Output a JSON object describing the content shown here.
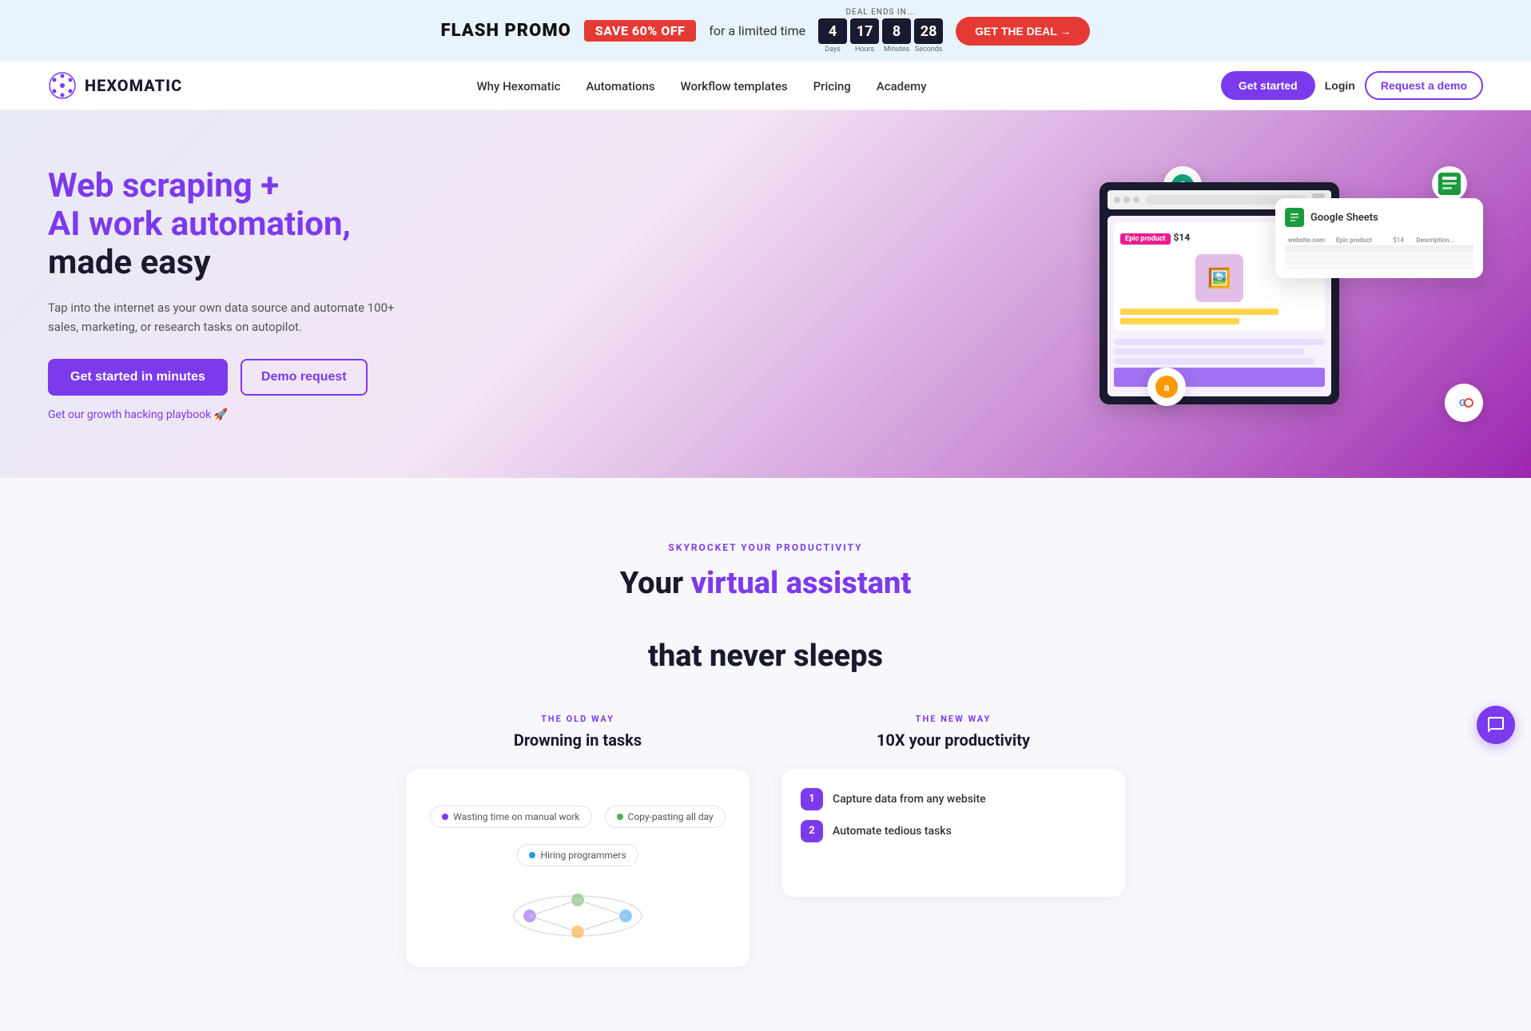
{
  "banner": {
    "flash_promo": "FLASH PROMO",
    "save_badge": "SAVE 60% OFF",
    "for_text": "for a limited time",
    "deal_ends_label": "DEAL ENDS IN...",
    "timer": {
      "days_value": "4",
      "days_label": "Days",
      "hours_value": "17",
      "hours_label": "Hours",
      "minutes_value": "8",
      "minutes_label": "Minutes",
      "seconds_value": "28",
      "seconds_label": "Seconds"
    },
    "get_deal_btn": "GET THE DEAL →"
  },
  "navbar": {
    "logo_text": "HEXOMATIC",
    "nav_items": [
      {
        "label": "Why Hexomatic",
        "id": "why"
      },
      {
        "label": "Automations",
        "id": "automations"
      },
      {
        "label": "Workflow templates",
        "id": "workflow"
      },
      {
        "label": "Pricing",
        "id": "pricing"
      },
      {
        "label": "Academy",
        "id": "academy"
      }
    ],
    "get_started": "Get started",
    "login": "Login",
    "request_demo": "Request a demo"
  },
  "hero": {
    "title_line1": "Web scraping +",
    "title_line2": "AI work automation,",
    "title_line3": "made easy",
    "subtitle": "Tap into the internet as your own data source and automate 100+ sales, marketing, or research tasks on autopilot.",
    "cta_primary": "Get started in minutes",
    "cta_secondary": "Demo request",
    "link_text": "Get our growth hacking playbook 🚀",
    "product_badge": "Epic product",
    "product_price": "$14",
    "sheets_title": "Google Sheets",
    "table_headers": [
      "website.com",
      "Epic product",
      "$14",
      "Description..."
    ],
    "table_rows": [
      [
        "",
        "",
        "",
        ""
      ],
      [
        "",
        "",
        "",
        ""
      ],
      [
        "",
        "",
        "",
        ""
      ],
      [
        "",
        "",
        "",
        ""
      ]
    ]
  },
  "productivity": {
    "section_tag": "SKYROCKET YOUR PRODUCTIVITY",
    "title_part1": "Your ",
    "title_highlight": "virtual assistant",
    "title_part2": "\nthat never sleeps",
    "old_way_tag": "THE OLD WAY",
    "old_way_heading": "Drowning in tasks",
    "old_way_tasks": [
      {
        "label": "Wasting time on manual work",
        "color": "purple"
      },
      {
        "label": "Copy-pasting all day",
        "color": "green"
      },
      {
        "label": "Hiring programmers",
        "color": "blue"
      }
    ],
    "new_way_tag": "THE NEW WAY",
    "new_way_heading": "10X your productivity",
    "new_way_features": [
      {
        "num": "1",
        "text": "Capture data from any website"
      },
      {
        "num": "2",
        "text": "Automate tedious tasks"
      }
    ]
  },
  "chat": {
    "icon": "💬"
  },
  "colors": {
    "purple": "#7c3aed",
    "red": "#e53935",
    "dark": "#1a1a2e"
  }
}
